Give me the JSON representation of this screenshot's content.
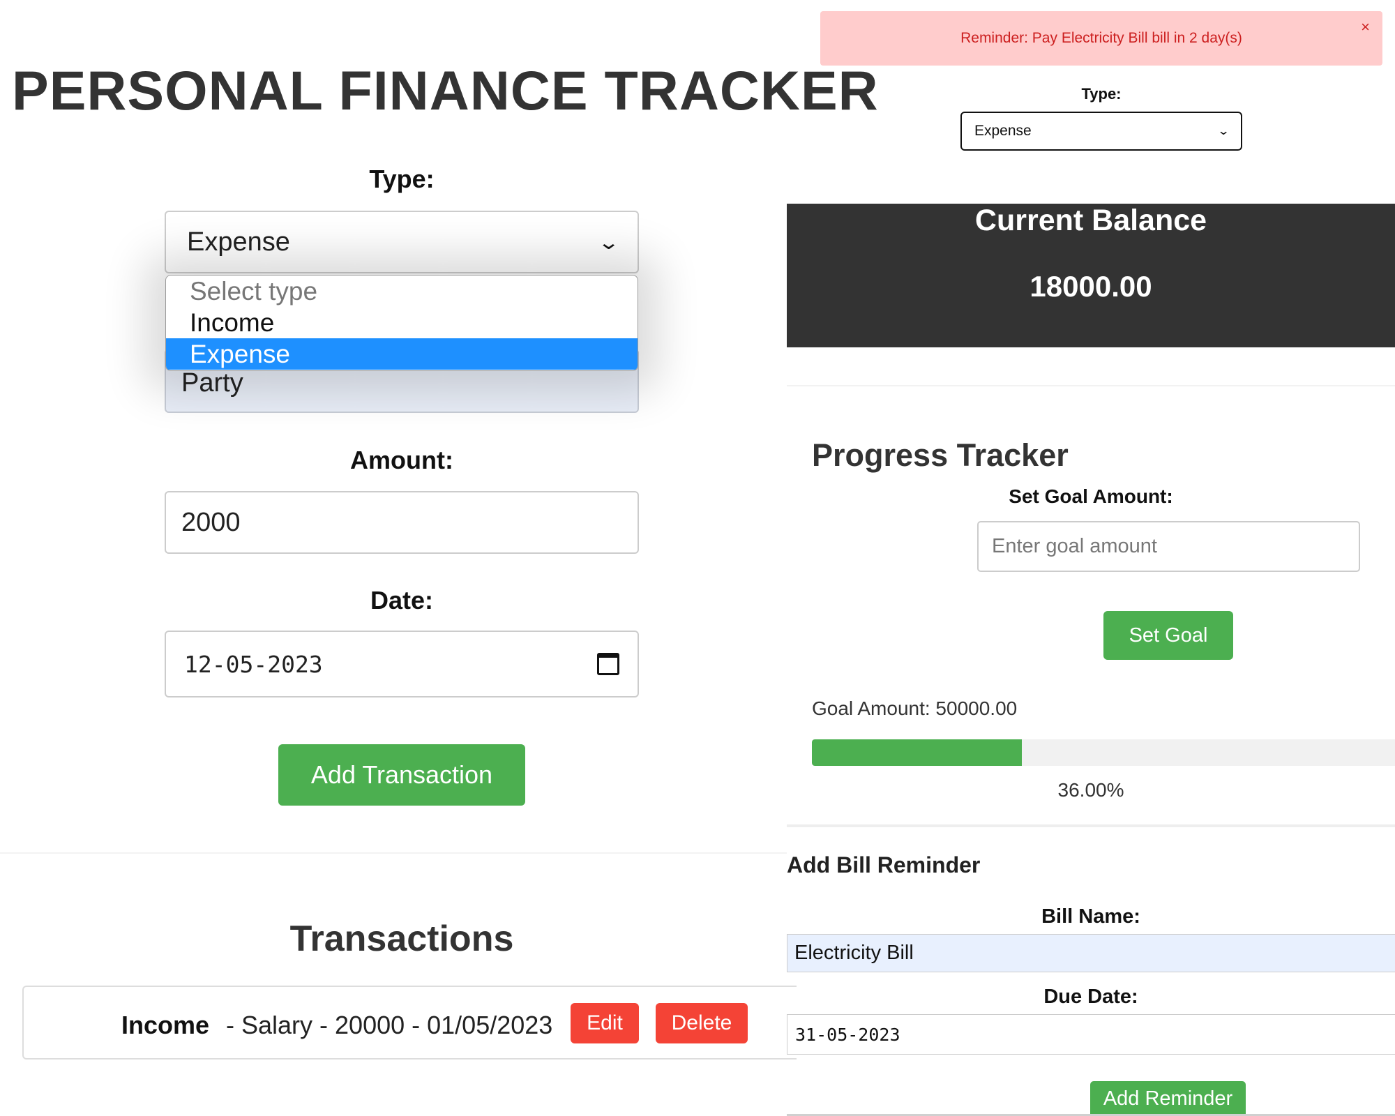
{
  "app": {
    "title": "PERSONAL FINANCE TRACKER"
  },
  "form": {
    "type_label": "Type:",
    "type_value": "Expense",
    "type_options": [
      "Select type",
      "Income",
      "Expense"
    ],
    "category_value": "Party",
    "amount_label": "Amount:",
    "amount_value": "2000",
    "date_label": "Date:",
    "date_value": "12-05-2023",
    "submit_label": "Add Transaction"
  },
  "transactions": {
    "heading": "Transactions",
    "items": [
      {
        "type": "Income",
        "details": "- Salary - 20000 - 01/05/2023",
        "edit_label": "Edit",
        "delete_label": "Delete"
      }
    ]
  },
  "reminder_banner": {
    "text": "Reminder: Pay Electricity Bill bill in 2 day(s)",
    "close": "×"
  },
  "filter": {
    "type_label": "Type:",
    "type_value": "Expense"
  },
  "balance": {
    "title": "Current Balance",
    "value": "18000.00"
  },
  "progress": {
    "heading": "Progress Tracker",
    "goal_label": "Set Goal Amount:",
    "goal_placeholder": "Enter goal amount",
    "set_goal_label": "Set Goal",
    "goal_amount_text": "Goal Amount: 50000.00",
    "percent_text": "36.00%",
    "fill_percent": 36
  },
  "bill_reminder": {
    "heading": "Add Bill Reminder",
    "name_label": "Bill Name:",
    "name_value": "Electricity Bill",
    "due_label": "Due Date:",
    "due_value": "31-05-2023",
    "add_label": "Add Reminder"
  },
  "colors": {
    "accent_green": "#4caf50",
    "danger_red": "#f44336",
    "highlight_blue": "#1e90ff",
    "panel_dark": "#333333",
    "banner_bg": "#ffcccc"
  },
  "icons": {
    "select_chevron": "chevron-down-icon",
    "date_picker": "calendar-icon",
    "banner_close": "close-icon"
  }
}
